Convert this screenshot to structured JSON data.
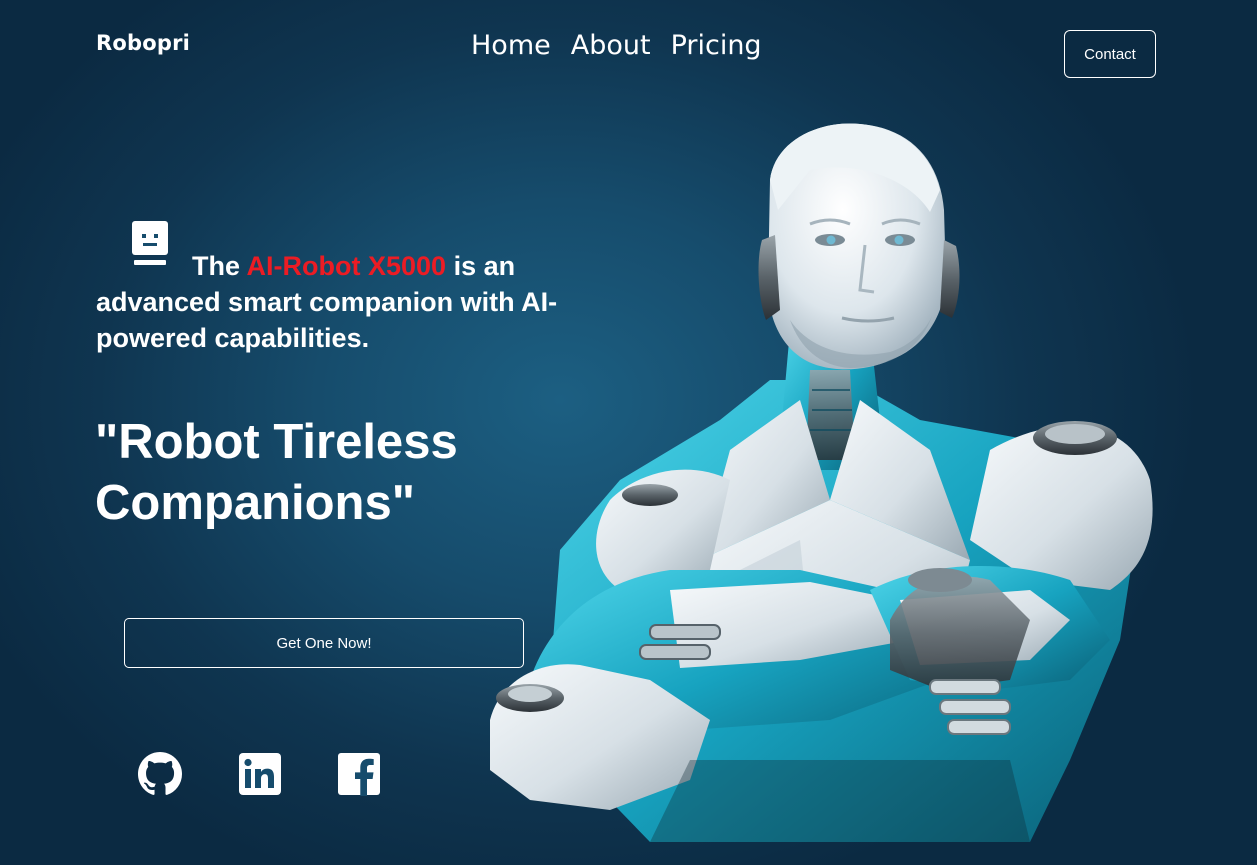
{
  "brand": {
    "name": "Robopri"
  },
  "nav": {
    "items": [
      "Home",
      "About",
      "Pricing"
    ]
  },
  "header": {
    "contact_label": "Contact"
  },
  "hero": {
    "intro_prefix": "The",
    "product_name": "AI-Robot X5000",
    "intro_suffix": "is an advanced smart companion with AI-powered capabilities.",
    "tagline_line1": "\"Robot Tireless",
    "tagline_line2": "Companions\"",
    "cta_label": "Get One Now!"
  },
  "social": {
    "items": [
      {
        "icon": "github-icon"
      },
      {
        "icon": "linkedin-icon"
      },
      {
        "icon": "facebook-icon"
      }
    ]
  },
  "colors": {
    "background": "#164c6c",
    "accent": "#ec1c24",
    "text": "#ffffff",
    "robot_cyan": "#22b8d4"
  }
}
